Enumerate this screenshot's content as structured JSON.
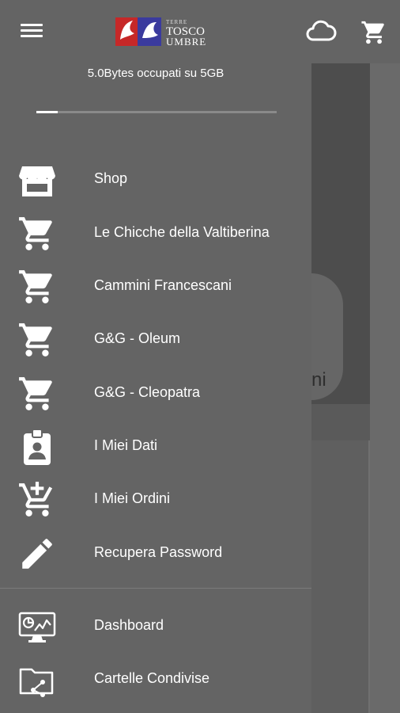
{
  "app": {
    "logo_text_small": "TERRE",
    "logo_text_1": "TOSCO",
    "logo_text_2": "UMBRE"
  },
  "icons": {
    "menu": "menu-icon",
    "cloud": "cloud-icon",
    "cart": "cart-icon"
  },
  "storage": {
    "text": "5.0Bytes occupati su 5GB",
    "used_fraction": 0.09
  },
  "menu": {
    "items": [
      {
        "label": "Shop",
        "icon": "store-icon"
      },
      {
        "label": "Le Chicche della Valtiberina",
        "icon": "cart-icon"
      },
      {
        "label": "Cammini Francescani",
        "icon": "cart-icon"
      },
      {
        "label": "G&G - Oleum",
        "icon": "cart-icon"
      },
      {
        "label": "G&G - Cleopatra",
        "icon": "cart-icon"
      },
      {
        "label": "I Miei Dati",
        "icon": "contact-badge-icon"
      },
      {
        "label": "I Miei Ordini",
        "icon": "cart-plus-icon"
      },
      {
        "label": "Recupera Password",
        "icon": "pencil-icon"
      }
    ],
    "secondary": [
      {
        "label": "Dashboard",
        "icon": "dashboard-monitor-icon"
      },
      {
        "label": "Cartelle Condivise",
        "icon": "shared-folder-icon"
      }
    ]
  },
  "background": {
    "partial_text": "ni"
  },
  "colors": {
    "drawer": "#646464",
    "text": "#ffffff"
  }
}
